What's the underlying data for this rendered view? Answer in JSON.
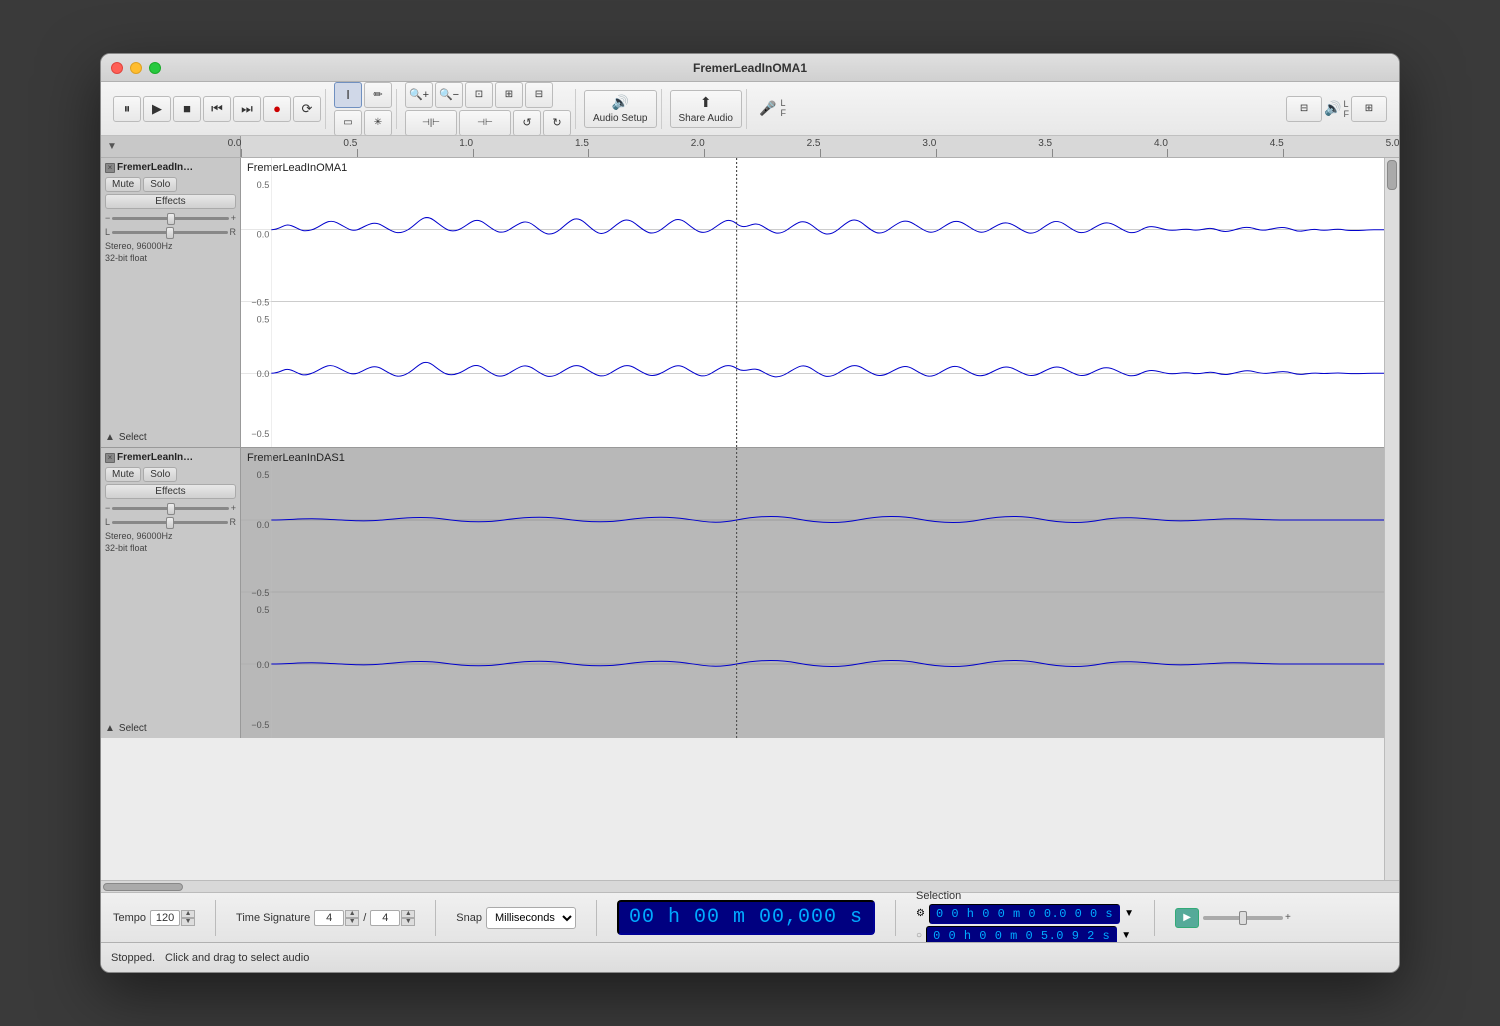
{
  "window": {
    "title": "FremerLeadInOMA1"
  },
  "toolbar": {
    "pause_label": "⏸",
    "play_label": "▶",
    "stop_label": "■",
    "rewind_label": "⏮",
    "forward_label": "⏭",
    "record_label": "●",
    "loop_label": "⟳",
    "cursor_label": "I",
    "draw_label": "✏",
    "zoom_in_label": "+",
    "zoom_out_label": "−",
    "zoom_fit_label": "⊡",
    "zoom_sel_label": "⊞",
    "zoom_width_label": "⊟",
    "trim_label": "||",
    "silence_label": "⊘",
    "audio_setup_label": "Audio Setup",
    "share_audio_label": "Share Audio",
    "audio_icon": "🔊",
    "share_icon": "⬆"
  },
  "ruler": {
    "marks": [
      "0.0",
      "0.5",
      "1.0",
      "1.5",
      "2.0",
      "2.5",
      "3.0",
      "3.5",
      "4.0",
      "4.5",
      "5.0"
    ]
  },
  "tracks": [
    {
      "id": "track1",
      "name": "FremerLeadIn…",
      "waveform_label": "FremerLeadInOMA1",
      "mute_label": "Mute",
      "solo_label": "Solo",
      "effects_label": "Effects",
      "info": "Stereo, 96000Hz\n32-bit float",
      "select_label": "Select",
      "gain_minus": "−",
      "gain_plus": "+",
      "pan_l": "L",
      "pan_r": "R",
      "active": true
    },
    {
      "id": "track2",
      "name": "FremerLeanIn…",
      "waveform_label": "FremerLeanInDAS1",
      "mute_label": "Mute",
      "solo_label": "Solo",
      "effects_label": "Effects",
      "info": "Stereo, 96000Hz\n32-bit float",
      "select_label": "Select",
      "gain_minus": "−",
      "gain_plus": "+",
      "pan_l": "L",
      "pan_r": "R",
      "active": false
    }
  ],
  "bottom_toolbar": {
    "tempo_label": "Tempo",
    "tempo_value": "120",
    "time_sig_label": "Time Signature",
    "numerator": "4",
    "denominator": "4",
    "snap_label": "Snap",
    "snap_value": "Milliseconds",
    "time_display": "00 h 00 m 00,000 s",
    "selection_label": "Selection",
    "sel_start": "0 0 h 0 0 m 0 0.0 0 0 s",
    "sel_end": "0 0 h 0 0 m 0 5.0 9 2 s",
    "status_stopped": "Stopped.",
    "status_hint": "Click and drag to select audio"
  }
}
